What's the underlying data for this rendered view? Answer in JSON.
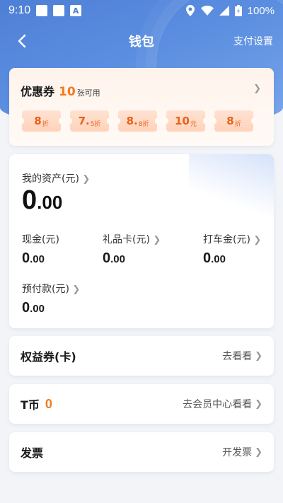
{
  "status": {
    "time": "9:10",
    "battery": "100%"
  },
  "nav": {
    "title": "钱包",
    "settings": "支付设置"
  },
  "coupon": {
    "label": "优惠券",
    "count": "10",
    "unit": "张可用",
    "tickets": [
      {
        "big": "8",
        "small": "折"
      },
      {
        "big": "7.",
        "small": "5折"
      },
      {
        "big": "8.",
        "small": "8折"
      },
      {
        "big": "10",
        "small": "元"
      },
      {
        "big": "8",
        "small": "折"
      }
    ]
  },
  "assets": {
    "title": "我的资产(元)",
    "total_int": "0",
    "total_dec": ".00",
    "cash": {
      "label": "现金(元)",
      "int": "0",
      "dec": ".00"
    },
    "gift": {
      "label": "礼品卡(元)",
      "int": "0",
      "dec": ".00"
    },
    "taxi": {
      "label": "打车金(元)",
      "int": "0",
      "dec": ".00"
    },
    "prepaid": {
      "label": "预付款(元)",
      "int": "0",
      "dec": ".00"
    }
  },
  "rights": {
    "label": "权益券(卡)",
    "link": "去看看"
  },
  "tcoin": {
    "label": "T币",
    "value": "0",
    "link": "去会员中心看看"
  },
  "invoice": {
    "label": "发票",
    "link": "开发票"
  },
  "icons": {
    "back": "back-arrow-icon",
    "chevron": "chevron-right-icon",
    "location": "location-icon",
    "wifi": "wifi-icon",
    "signal": "signal-icon",
    "battery": "battery-icon"
  },
  "colors": {
    "accent": "#f27a1a",
    "header": "#4e7fd6"
  }
}
